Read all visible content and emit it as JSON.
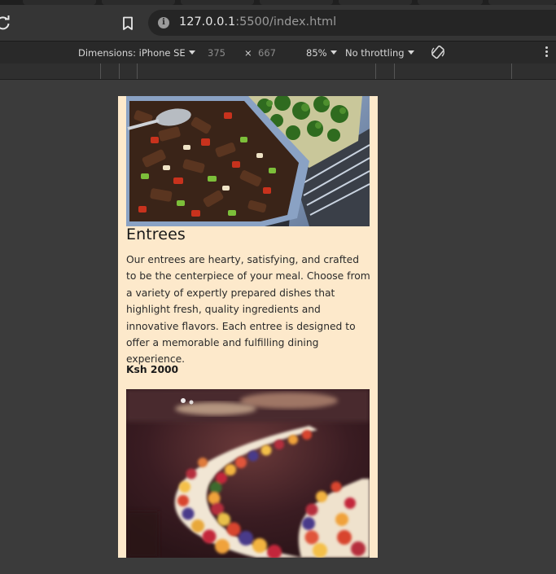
{
  "browser": {
    "url_host": "127.0.0.1",
    "url_rest": ":5500/index.html"
  },
  "devtools": {
    "dimensions_label": "Dimensions: iPhone SE",
    "width": "375",
    "times": "×",
    "height": "667",
    "zoom": "85%",
    "throttling": "No throttling"
  },
  "page": {
    "section_title": "Entrees",
    "section_description": "Our entrees are hearty, satisfying, and crafted to be the centerpiece of your meal. Choose from a variety of expertly prepared dishes that highlight fresh, quality ingredients and innovative flavors. Each entree is designed to offer a memorable and fulfilling dining experience.",
    "price": "Ksh 2000"
  },
  "icons": [
    "reload-icon",
    "bookmark-icon",
    "site-info-icon",
    "rotate-icon",
    "more-options-icon"
  ],
  "colors": {
    "page_background": "#fde9cb",
    "chrome_dark": "#3b3b3b"
  }
}
